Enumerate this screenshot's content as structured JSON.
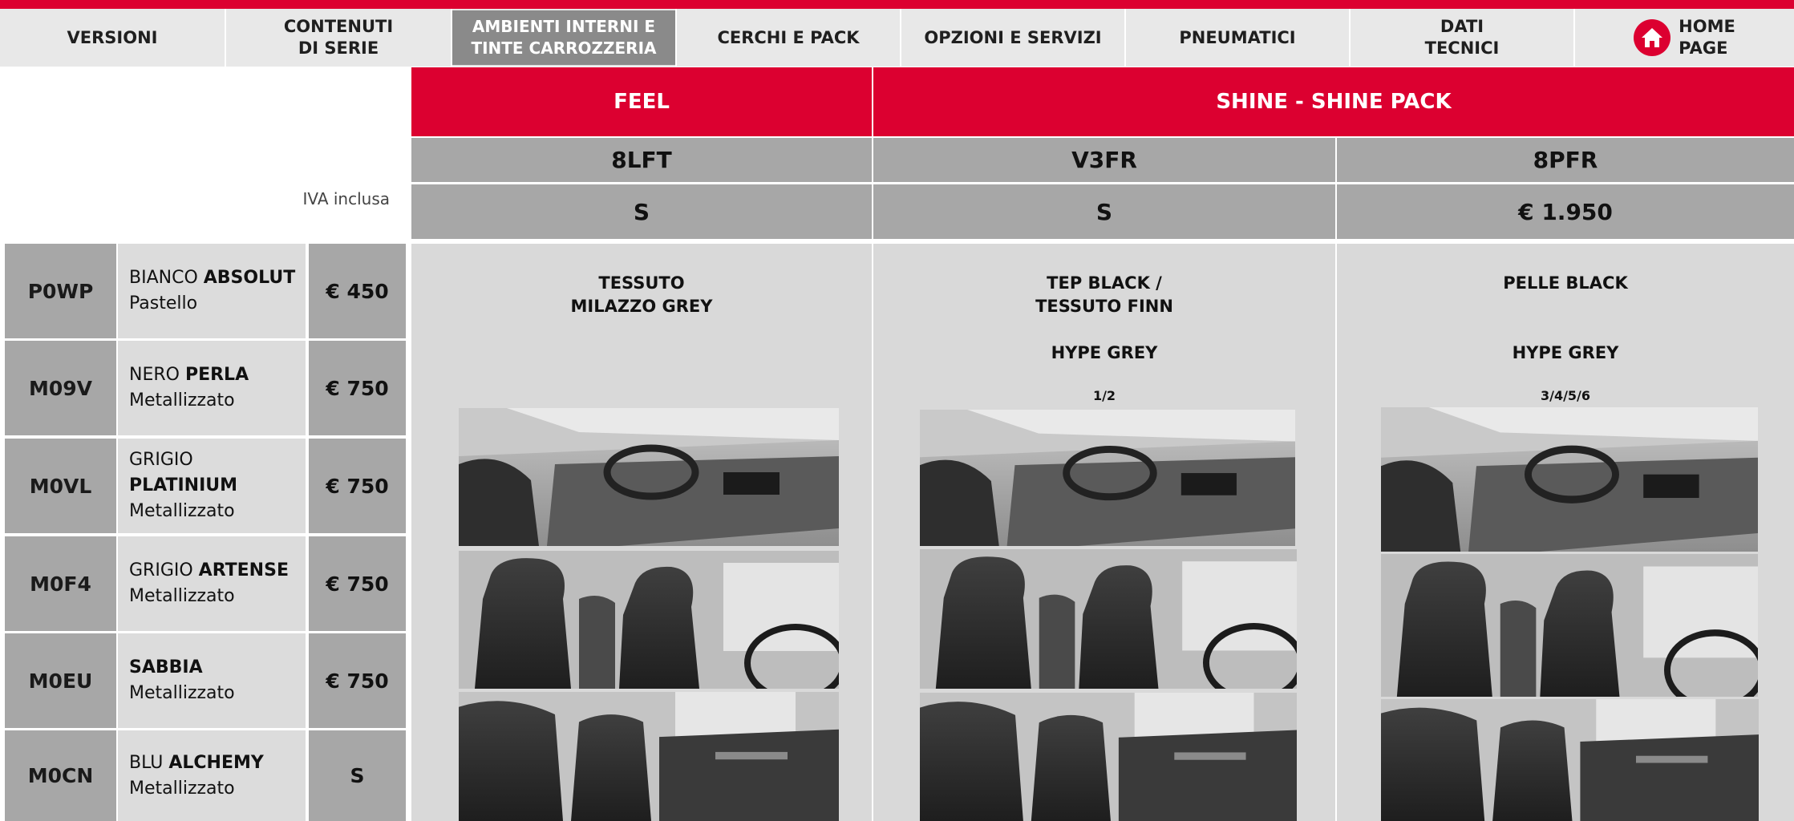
{
  "nav": {
    "versioni": "VERSIONI",
    "contenuti": "CONTENUTI\nDI SERIE",
    "ambienti": "AMBIENTI INTERNI E\nTINTE CARROZZERIA",
    "cerchi": "CERCHI E PACK",
    "opzioni": "OPZIONI E SERVIZI",
    "pneumatici": "PNEUMATICI",
    "dati": "DATI\nTECNICI",
    "home": "HOME\nPAGE"
  },
  "header": {
    "feel": "FEEL",
    "shine": "SHINE - SHINE PACK",
    "codes": [
      "8LFT",
      "V3FR",
      "8PFR"
    ],
    "prices": [
      "S",
      "S",
      "€ 1.950"
    ],
    "iva": "IVA inclusa"
  },
  "colors": [
    {
      "code": "P0WP",
      "first": "BIANCO ",
      "bold": "ABSOLUT",
      "type": "Pastello",
      "price": "€ 450"
    },
    {
      "code": "M09V",
      "first": "NERO ",
      "bold": "PERLA",
      "type": "Metallizzato",
      "price": "€ 750"
    },
    {
      "code": "M0VL",
      "first": "GRIGIO ",
      "bold": "PLATINIUM",
      "type": "Metallizzato",
      "price": "€ 750"
    },
    {
      "code": "M0F4",
      "first": "GRIGIO ",
      "bold": "ARTENSE",
      "type": "Metallizzato",
      "price": "€ 750"
    },
    {
      "code": "M0EU",
      "first": "",
      "bold": "SABBIA",
      "type": "Metallizzato",
      "price": "€ 750"
    },
    {
      "code": "M0CN",
      "first": "BLU ",
      "bold": "ALCHEMY",
      "type": "Metallizzato",
      "price": "S"
    }
  ],
  "interiors": [
    {
      "title": "TESSUTO\nMILAZZO GREY",
      "sub": "",
      "seats": ""
    },
    {
      "title": "TEP BLACK /\nTESSUTO FINN",
      "sub": "HYPE GREY",
      "seats": "1/2"
    },
    {
      "title": "PELLE BLACK",
      "sub": "HYPE GREY",
      "seats": "3/4/5/6"
    }
  ],
  "theme": {
    "accent": "#dc0030",
    "gray_dark": "#a7a7a7",
    "gray_light": "#dcdcdc",
    "active_tab": "#8a8a8a"
  }
}
